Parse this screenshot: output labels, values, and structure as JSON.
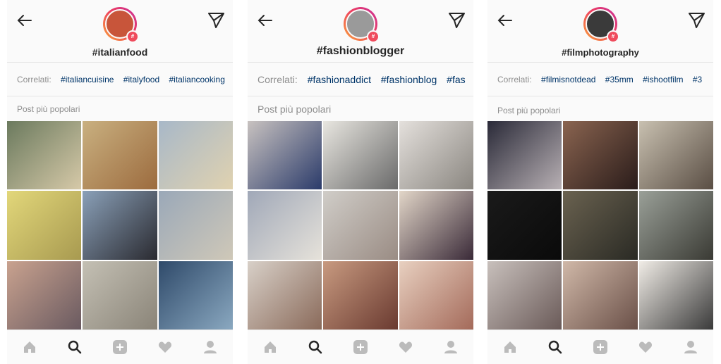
{
  "screens": [
    {
      "hashtag": "#italianfood",
      "related_label": "Correlati:",
      "related": [
        "#italiancuisine",
        "#italyfood",
        "#italiancooking"
      ],
      "section_title": "Post più popolari",
      "badge": "#",
      "avatar_color": "#c8553a",
      "tiles": [
        "#6b7a5e",
        "#b98a5a",
        "#a8b8c8",
        "#e2d77a",
        "#3a4a5a",
        "#9aa8b8",
        "#c9a28f",
        "#c4c0b4",
        "#2f4a6a"
      ]
    },
    {
      "hashtag": "#fashionblogger",
      "related_label": "Correlati:",
      "related": [
        "#fashionaddict",
        "#fashionblog",
        "#fas"
      ],
      "section_title": "Post più popolari",
      "badge": "#",
      "avatar_color": "#9a9a9a",
      "tiles": [
        "#2b3b6a",
        "#d8d8d8",
        "#cfcac4",
        "#c9c4b8",
        "#b8b4ae",
        "#5a4a58",
        "#b8a59a",
        "#a87560",
        "#d8b6a6"
      ]
    },
    {
      "hashtag": "#filmphotography",
      "related_label": "Correlati:",
      "related": [
        "#filmisnotdead",
        "#35mm",
        "#ishootfilm",
        "#3"
      ],
      "section_title": "Post più popolari",
      "badge": "#",
      "avatar_color": "#3a3a3a",
      "tiles": [
        "#3a2f3a",
        "#5a4436",
        "#8a7e70",
        "#141414",
        "#5a5240",
        "#6a6a5a",
        "#9a8a84",
        "#b49a8a",
        "#dad6cf"
      ]
    }
  ],
  "colors": {
    "link": "#003569",
    "muted": "#8e8e8e",
    "icon": "#262626",
    "nav_icon": "#262626"
  }
}
